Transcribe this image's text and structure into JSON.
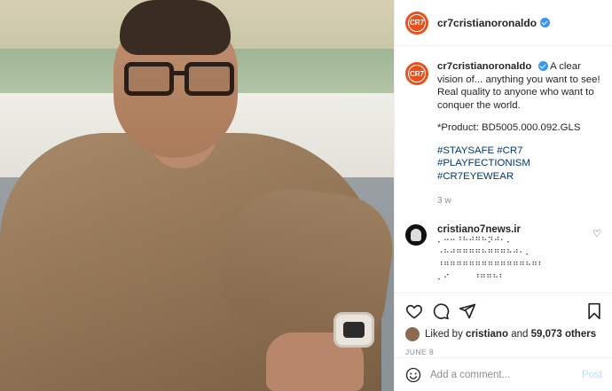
{
  "header": {
    "username": "cr7cristianoronaldo",
    "avatar_text": "CR7",
    "verified": true
  },
  "caption": {
    "username": "cr7cristianoronaldo",
    "line1": "A clear vision of... anything you want to see!",
    "line2": "Real quality to anyone who want to conquer the world.",
    "product": "*Product: BD5005.000.092.GLS",
    "tags": "#STAYSAFE #CR7 #PLAYFECTIONISM #CR7EYEWEAR",
    "time": "3 w"
  },
  "comment": {
    "username": "cristiano7news.ir",
    "lines": [
      "⠄⠒⠒⠘⠓⠚⠛⠓⠝⠚⠂⠄",
      "⠐⠓⠚⠛⠛⠛⠛⠓⠛⠛⠛⠓⠚⠂⠄",
      "",
      "⠘⠛⠛⠛⠛⠛⠛⠛⠛⠛⠛⠛⠛⠛⠓⠛⠃",
      "",
      "⠄⠊        ⠘⠛⠛⠓⠃"
    ]
  },
  "actions": {
    "liked_prefix": "Liked by",
    "liked_user": "cristiano",
    "liked_and": "and",
    "likes_count": "59,073 others",
    "date": "JUNE 8"
  },
  "add_comment": {
    "placeholder": "Add a comment...",
    "post_label": "Post"
  },
  "colors": {
    "brand": "#e8511d",
    "link": "#00376b",
    "verified": "#3897f0",
    "post_disabled": "#b2dffc"
  }
}
